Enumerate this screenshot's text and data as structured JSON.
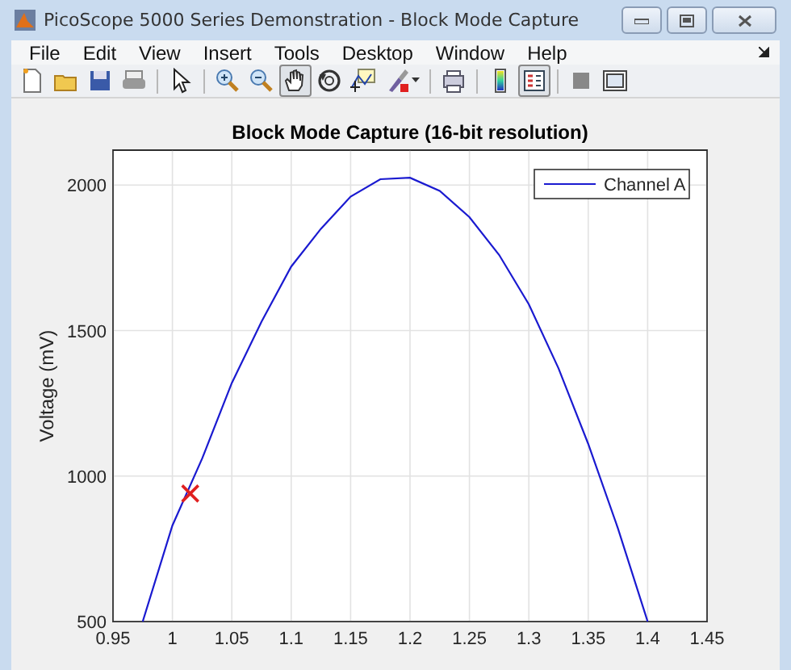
{
  "window": {
    "title": "PicoScope 5000 Series Demonstration - Block Mode Capture"
  },
  "menu": [
    "File",
    "Edit",
    "View",
    "Insert",
    "Tools",
    "Desktop",
    "Window",
    "Help"
  ],
  "toolbar": [
    {
      "selected": false
    },
    {
      "selected": false
    },
    {
      "selected": false
    },
    {
      "selected": false
    },
    {
      "selected": false
    },
    {
      "selected": false
    },
    {
      "selected": false
    },
    {
      "selected": true
    },
    {
      "selected": false
    },
    {
      "selected": false
    },
    {
      "selected": false
    },
    {
      "selected": false
    },
    {
      "selected": false
    },
    {
      "selected": true
    },
    {
      "selected": false
    },
    {
      "selected": false
    }
  ],
  "figure": {
    "chart_data": {
      "type": "line",
      "title": "Block Mode Capture (16-bit resolution)",
      "ylabel": "Voltage (mV)",
      "x": [
        0.975,
        1.0,
        1.025,
        1.05,
        1.075,
        1.1,
        1.125,
        1.15,
        1.175,
        1.2,
        1.225,
        1.25,
        1.275,
        1.3,
        1.325,
        1.35,
        1.375,
        1.4
      ],
      "series": [
        {
          "name": "Channel A",
          "color": "#1a1ad0",
          "values": [
            500,
            830,
            1060,
            1320,
            1530,
            1720,
            1850,
            1960,
            2020,
            2025,
            1980,
            1890,
            1760,
            1590,
            1370,
            1110,
            820,
            500
          ]
        }
      ],
      "xlim": [
        0.95,
        1.45
      ],
      "ylim": [
        500,
        2120
      ],
      "xticks": [
        0.95,
        1,
        1.05,
        1.1,
        1.15,
        1.2,
        1.25,
        1.3,
        1.35,
        1.4,
        1.45
      ],
      "yticks": [
        500,
        1000,
        1500,
        2000
      ],
      "grid": true
    }
  }
}
